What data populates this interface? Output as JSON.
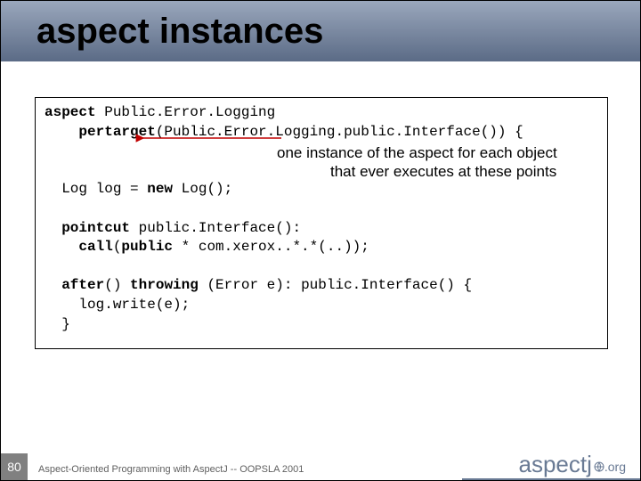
{
  "title": "aspect instances",
  "code": {
    "line1_kw": "aspect",
    "line1_rest": " Public.Error.Logging",
    "line2_pre": "    ",
    "line2_kw": "pertarget",
    "line2_rest": "(Public.Error.Logging.public.Interface()) {",
    "line_log_pre": "  Log log = ",
    "line_log_kw": "new",
    "line_log_rest": " Log();",
    "line_pc_pre": "  ",
    "line_pc_kw": "pointcut",
    "line_pc_rest": " public.Interface():",
    "line_pc2_pre": "    ",
    "line_pc2_kw1": "call",
    "line_pc2_mid1": "(",
    "line_pc2_kw2": "public",
    "line_pc2_rest": " * com.xerox..*.*(..));",
    "line_after_pre": "  ",
    "line_after_kw1": "after",
    "line_after_mid1": "() ",
    "line_after_kw2": "throwing",
    "line_after_rest": " (Error e): public.Interface() {",
    "line_write": "    log.write(e);",
    "line_close1": "  }"
  },
  "annotation_line1": "one instance of the aspect for each object",
  "annotation_line2": "that ever executes at these points",
  "page_number": "80",
  "footer": "Aspect-Oriented Programming with AspectJ -- OOPSLA 2001",
  "logo_main": "aspectj",
  "logo_sub": ".org"
}
